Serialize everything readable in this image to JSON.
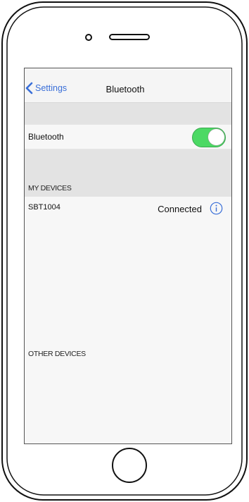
{
  "nav": {
    "back_label": "Settings",
    "title": "Bluetooth"
  },
  "bluetooth": {
    "label": "Bluetooth",
    "enabled": true,
    "toggle_color": "#4cd964"
  },
  "my_devices": {
    "header": "MY DEVICES",
    "items": [
      {
        "name": "SBT1004",
        "status": "Connected",
        "icon": "info-icon"
      }
    ]
  },
  "other_devices": {
    "header": "OTHER DEVICES"
  },
  "colors": {
    "link": "#3a6fd8",
    "toggle_on": "#4cd964"
  }
}
